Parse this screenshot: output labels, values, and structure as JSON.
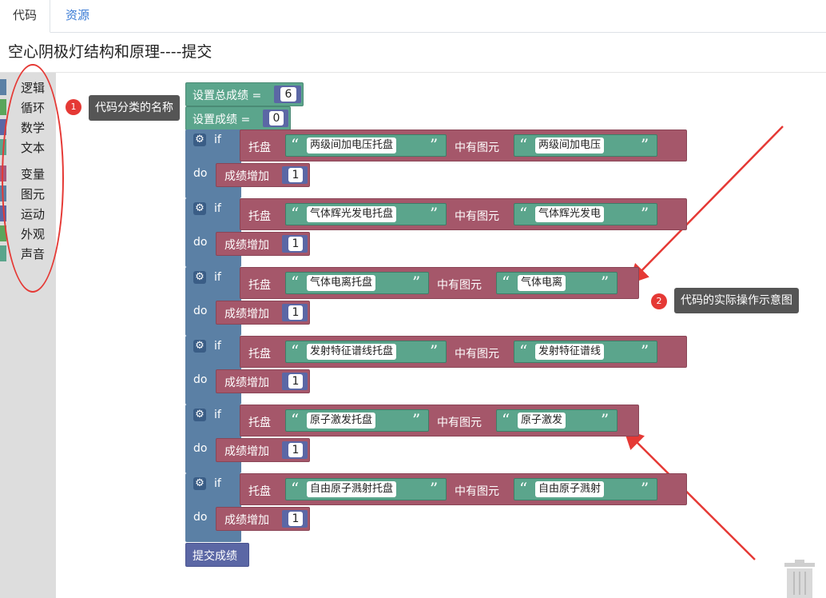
{
  "tabs": [
    {
      "label": "代码"
    },
    {
      "label": "资源"
    }
  ],
  "page_title": "空心阴极灯结构和原理----提交",
  "toolbox": {
    "categories": [
      {
        "label": "逻辑",
        "color": "#5b80a5"
      },
      {
        "label": "循环",
        "color": "#5ba55b"
      },
      {
        "label": "数学",
        "color": "#5b67a5"
      },
      {
        "label": "文本",
        "color": "#5ba58c"
      },
      {
        "label": "变量",
        "color": "#a55b80"
      },
      {
        "label": "图元",
        "color": "#5b80a5"
      },
      {
        "label": "运动",
        "color": "#5b67a5"
      },
      {
        "label": "外观",
        "color": "#5ba55b"
      },
      {
        "label": "声音",
        "color": "#5ba58c"
      }
    ]
  },
  "annotations": [
    {
      "num": "1",
      "text": "代码分类的名称"
    },
    {
      "num": "2",
      "text": "代码的实际操作示意图"
    }
  ],
  "blocks": {
    "set_total": {
      "label": "设置总成绩 =",
      "value": "6"
    },
    "set_score": {
      "label": "设置成绩 =",
      "value": "0"
    },
    "if_label": "if",
    "do_label": "do",
    "tray_label": "托盘",
    "has_label": "中有图元",
    "add_label": "成绩增加",
    "submit_label": "提交成绩",
    "rules": [
      {
        "tray": "两级间加电压托盘",
        "item": "两级间加电压",
        "add": "1"
      },
      {
        "tray": "气体辉光发电托盘",
        "item": "气体辉光发电",
        "add": "1"
      },
      {
        "tray": "气体电离托盘",
        "item": "气体电离",
        "add": "1"
      },
      {
        "tray": "发射特征谱线托盘",
        "item": "发射特征谱线",
        "add": "1"
      },
      {
        "tray": "原子激发托盘",
        "item": "原子激发",
        "add": "1"
      },
      {
        "tray": "自由原子溅射托盘",
        "item": "自由原子溅射",
        "add": "1"
      }
    ]
  },
  "colors": {
    "logic": "#5b80a5",
    "text": "#5ba58c",
    "variable": "#a5576a",
    "event": "#5b67a5",
    "annotation": "#e53935"
  }
}
